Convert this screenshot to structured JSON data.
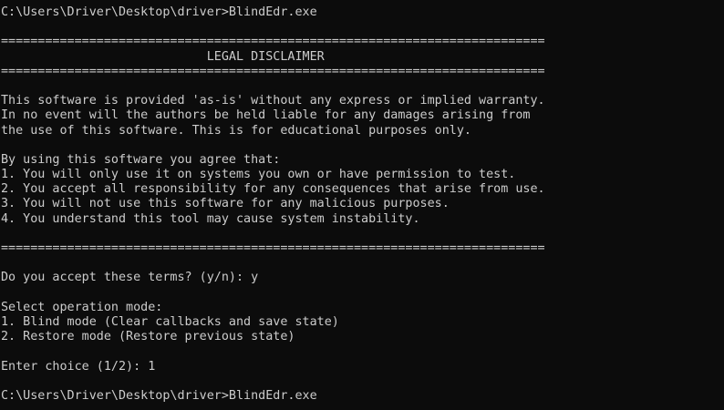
{
  "console": {
    "prompt1": "C:\\Users\\Driver\\Desktop\\driver>BlindEdr.exe",
    "separator": "==========================================================================",
    "disclaimer_title": "                            LEGAL DISCLAIMER",
    "disclaimer_lines": [
      "This software is provided 'as-is' without any express or implied warranty.",
      "In no event will the authors be held liable for any damages arising from",
      "the use of this software. This is for educational purposes only."
    ],
    "agree_intro": "By using this software you agree that:",
    "agree_items": [
      "1. You will only use it on systems you own or have permission to test.",
      "2. You accept all responsibility for any consequences that arise from use.",
      "3. You will not use this software for any malicious purposes.",
      "4. You understand this tool may cause system instability."
    ],
    "accept_prompt": "Do you accept these terms? (y/n): y",
    "mode_header": "Select operation mode:",
    "mode_options": [
      "1. Blind mode (Clear callbacks and save state)",
      "2. Restore mode (Restore previous state)"
    ],
    "choice_prompt": "Enter choice (1/2): 1",
    "prompt2": "C:\\Users\\Driver\\Desktop\\driver>BlindEdr.exe"
  }
}
